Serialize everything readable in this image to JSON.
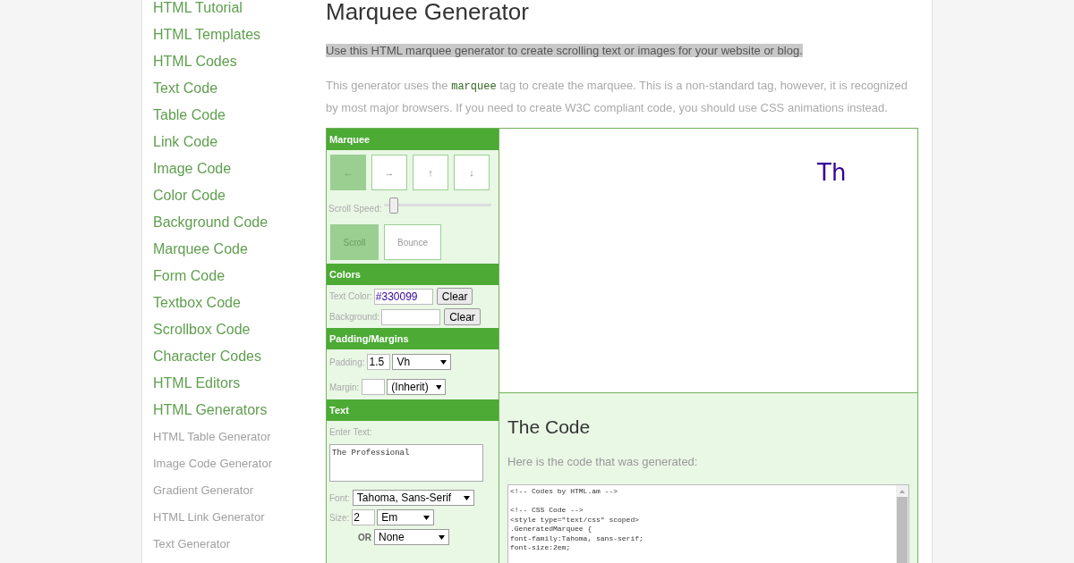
{
  "sidebar": {
    "items": [
      {
        "label": "HTML Tutorial",
        "kind": "link"
      },
      {
        "label": "HTML Templates",
        "kind": "link"
      },
      {
        "label": "HTML Codes",
        "kind": "link"
      },
      {
        "label": "Text Code",
        "kind": "link"
      },
      {
        "label": "Table Code",
        "kind": "link"
      },
      {
        "label": "Link Code",
        "kind": "link"
      },
      {
        "label": "Image Code",
        "kind": "link"
      },
      {
        "label": "Color Code",
        "kind": "link"
      },
      {
        "label": "Background Code",
        "kind": "link"
      },
      {
        "label": "Marquee Code",
        "kind": "link"
      },
      {
        "label": "Form Code",
        "kind": "link"
      },
      {
        "label": "Textbox Code",
        "kind": "link"
      },
      {
        "label": "Scrollbox Code",
        "kind": "link"
      },
      {
        "label": "Character Codes",
        "kind": "link"
      },
      {
        "label": "HTML Editors",
        "kind": "link"
      },
      {
        "label": "HTML Generators",
        "kind": "link"
      },
      {
        "label": "HTML Table Generator",
        "kind": "sublink"
      },
      {
        "label": "Image Code Generator",
        "kind": "sublink"
      },
      {
        "label": "Gradient Generator",
        "kind": "sublink"
      },
      {
        "label": "HTML Link Generator",
        "kind": "sublink"
      },
      {
        "label": "Text Generator",
        "kind": "sublink"
      }
    ]
  },
  "title": "Marquee Generator",
  "intro": "Use this HTML marquee generator to create scrolling text or images for your website or blog.",
  "description": {
    "before": "This generator uses the",
    "code": "marquee",
    "after": "tag to create the marquee. This is a non-standard tag, however, it is recognized by most major browsers. If you need to create W3C compliant code, you should use CSS animations instead."
  },
  "panel": {
    "marquee": {
      "heading": "Marquee",
      "directions": [
        {
          "glyph": "←",
          "selected": true
        },
        {
          "glyph": "→",
          "selected": false
        },
        {
          "glyph": "↑",
          "selected": false
        },
        {
          "glyph": "↓",
          "selected": false
        }
      ],
      "speed_label": "Scroll Speed:",
      "speed": {
        "level": 0.06
      },
      "behaviors": [
        {
          "label": "Scroll",
          "selected": true
        },
        {
          "label": "Bounce",
          "selected": false
        }
      ]
    },
    "colors": {
      "heading": "Colors",
      "rows": [
        {
          "label": "Text Color:",
          "value": "#330099",
          "button": "Clear"
        },
        {
          "label": "Background:",
          "button": "Clear"
        }
      ]
    },
    "padding": {
      "heading": "Padding/Margins",
      "rows": [
        {
          "label": "Padding:",
          "value": "1.5",
          "unit": "Vh"
        },
        {
          "label": "Margin:",
          "unit": "(Inherit)"
        }
      ]
    },
    "text": {
      "heading": "Text",
      "enter_label": "Enter Text:",
      "value": "The Professional",
      "font_label": "Font:",
      "font": "Tahoma, Sans-Serif",
      "size_label": "Size:",
      "size": "2",
      "size_unit": "Em",
      "or_label": "OR",
      "or_value": "None"
    }
  },
  "preview": {
    "text": "Th",
    "color": "#330099"
  },
  "code_section": {
    "heading": "The Code",
    "subtitle": "Here is the code that was generated:",
    "blocks": [
      [
        "<!-- Codes by HTML.am -->"
      ],
      [
        "<!-- CSS Code -->",
        "<style type=\"text/css\" scoped>",
        ".GeneratedMarquee {",
        "font-family:Tahoma, sans-serif;",
        "font-size:2em;"
      ]
    ]
  }
}
